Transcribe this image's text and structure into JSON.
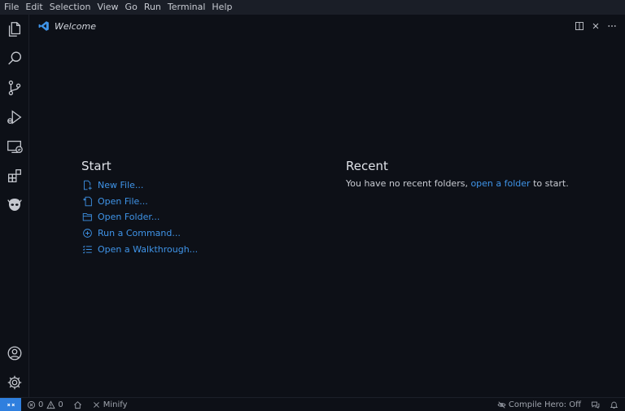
{
  "menubar": {
    "items": [
      "File",
      "Edit",
      "Selection",
      "View",
      "Go",
      "Run",
      "Terminal",
      "Help"
    ]
  },
  "activitybar": {
    "top_icons": [
      "explorer-icon",
      "search-icon",
      "source-control-icon",
      "run-debug-icon",
      "remote-explorer-icon",
      "extensions-icon",
      "alien-icon"
    ],
    "bottom_icons": [
      "account-icon",
      "settings-gear-icon"
    ]
  },
  "tab": {
    "label": "Welcome",
    "icon": "vscode-logo-icon",
    "actions": [
      "split-editor-icon",
      "close-icon",
      "more-actions-icon"
    ]
  },
  "welcome": {
    "start": {
      "title": "Start",
      "items": [
        {
          "label": "New File...",
          "icon": "new-file-icon"
        },
        {
          "label": "Open File...",
          "icon": "open-file-icon"
        },
        {
          "label": "Open Folder...",
          "icon": "open-folder-icon"
        },
        {
          "label": "Run a Command...",
          "icon": "run-command-icon"
        },
        {
          "label": "Open a Walkthrough...",
          "icon": "walkthrough-icon"
        }
      ]
    },
    "recent": {
      "title": "Recent",
      "text_before": "You have no recent folders, ",
      "link": "open a folder",
      "text_after": " to start."
    }
  },
  "statusbar": {
    "errors": "0",
    "warnings": "0",
    "minify": "Minify",
    "compile_hero": "Compile Hero: Off"
  },
  "colors": {
    "accent": "#3f94e8",
    "remote_badge": "#2f7fde",
    "background": "#0d1017",
    "menubar": "#1a1e27"
  }
}
